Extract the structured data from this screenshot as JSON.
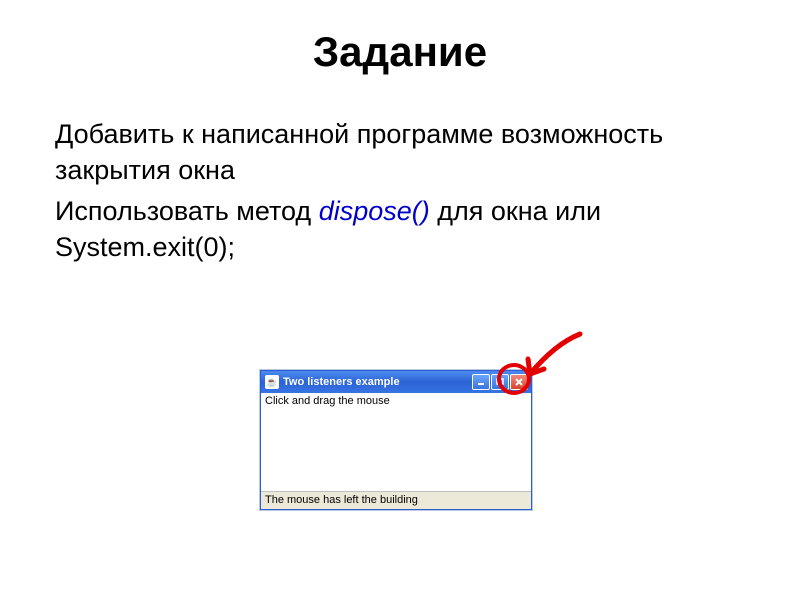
{
  "title": "Задание",
  "paragraph1": "Добавить к написанной программе возможность закрытия окна",
  "paragraph2_part1": "Использовать метод ",
  "paragraph2_method": "dispose()",
  "paragraph2_part2": " для окна или System.exit(0);",
  "window": {
    "java_icon": "☕",
    "title": "Two listeners example",
    "minimize": "_",
    "maximize": "□",
    "close": "✕",
    "content": "Click and drag the mouse",
    "status": "The mouse has left the building"
  }
}
